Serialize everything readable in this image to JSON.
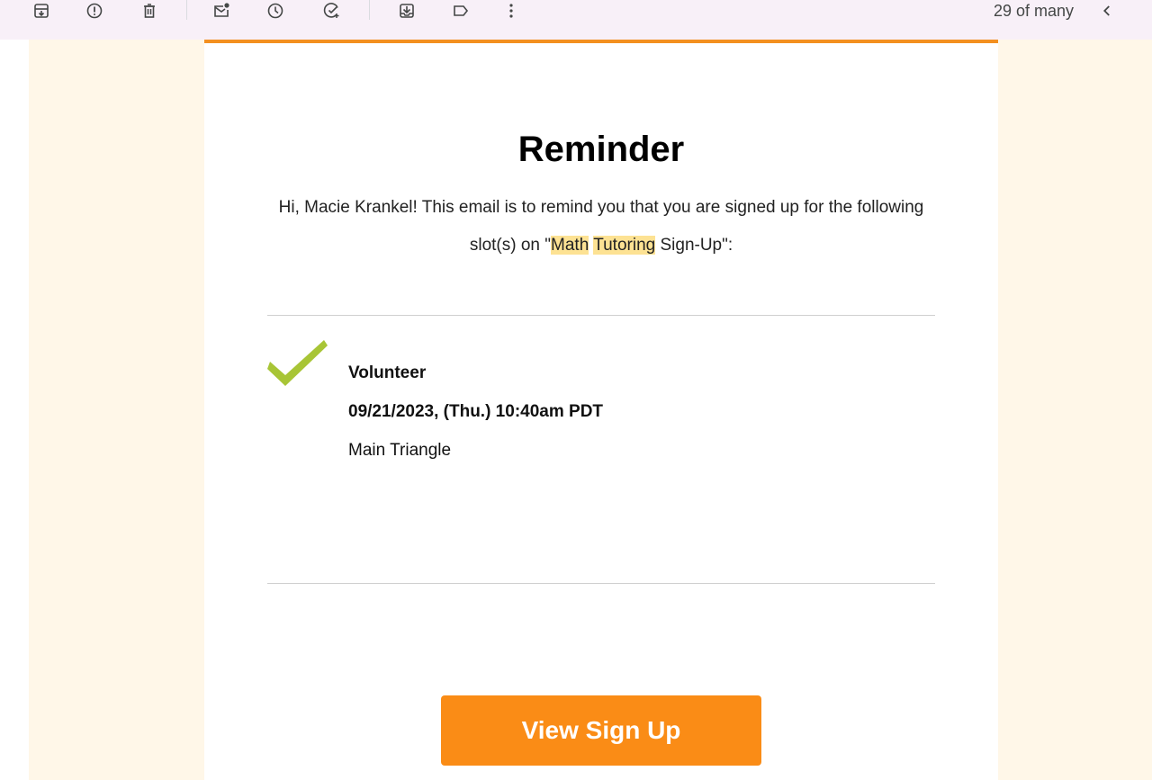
{
  "toolbar": {
    "pager_text": "29 of many"
  },
  "email": {
    "title": "Reminder",
    "intro_before": "Hi, Macie Krankel! This email is to remind you that you are signed up for the following slot(s) on \"",
    "highlight_1": "Math",
    "highlight_2": "Tutoring",
    "intro_after": " Sign-Up\":",
    "slot": {
      "role": "Volunteer",
      "datetime": "09/21/2023, (Thu.) 10:40am PDT",
      "location": "Main Triangle"
    },
    "cta_label": "View Sign Up"
  },
  "colors": {
    "toolbar_bg": "#f8f0f8",
    "email_bg": "#fff7e8",
    "accent": "#f39020",
    "button": "#fa8c16",
    "check": "#a8c536",
    "highlight": "#fde293"
  },
  "icons": [
    "archive-icon",
    "report-spam-icon",
    "delete-icon",
    "mark-unread-icon",
    "snooze-icon",
    "add-task-icon",
    "move-to-icon",
    "label-icon",
    "more-vert-icon",
    "chevron-left-icon",
    "checkmark-icon"
  ]
}
